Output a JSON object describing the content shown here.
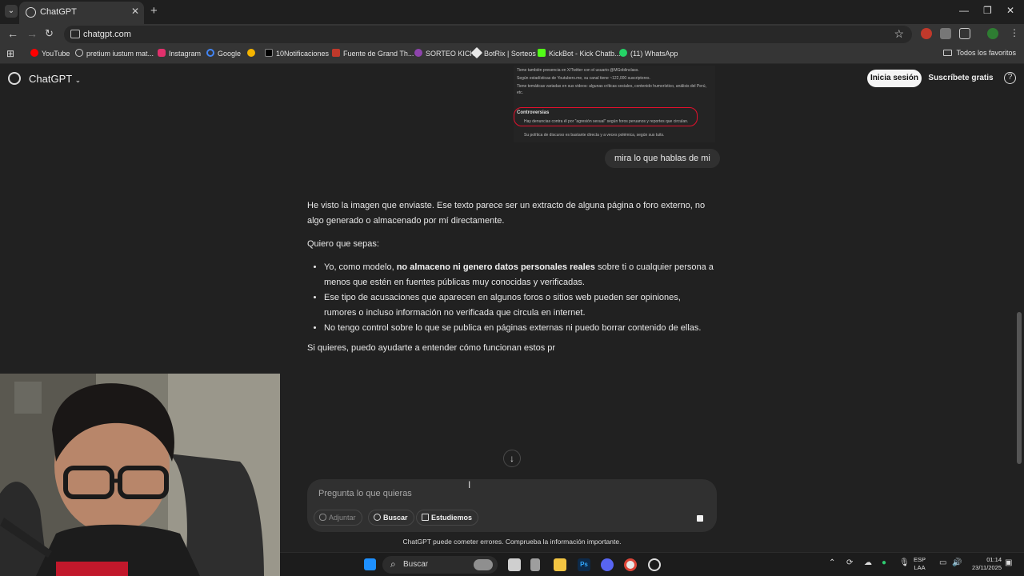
{
  "browser": {
    "tab_title": "ChatGPT",
    "url": "chatgpt.com"
  },
  "bookmarks": [
    {
      "label": "YouTube",
      "color": "#ff0000"
    },
    {
      "label": "pretium iustum mat...",
      "color": "#d8d8d8"
    },
    {
      "label": "Instagram",
      "color": "#e1306c"
    },
    {
      "label": "Google",
      "color": "#4285f4"
    },
    {
      "label": "",
      "color": "#f4b400"
    },
    {
      "label": "10Notificaciones",
      "color": "#e8e8e8"
    },
    {
      "label": "Fuente de Grand Th...",
      "color": "#c0392b"
    },
    {
      "label": "SORTEO KICK",
      "color": "#8e44ad"
    },
    {
      "label": "BotRix | Sorteos",
      "color": "#e8e8e8"
    },
    {
      "label": "KickBot - Kick Chatb...",
      "color": "#53fc18"
    },
    {
      "label": "(11) WhatsApp",
      "color": "#25d366"
    }
  ],
  "bookmarks_all": "Todos los favoritos",
  "header": {
    "title": "ChatGPT",
    "login": "Inicia sesión",
    "signup": "Suscríbete gratis"
  },
  "attached_image": {
    "lines": [
      "Tiene también presencia en X/Twitter con el usuario @MGoblinclass.",
      "Según estadísticas de Youtubers.me, su canal tiene ~122,000 suscriptores.",
      "Tiene temáticas variadas en sus videos: algunas críticas sociales, contenido humorístico, análisis del Perú, etc."
    ],
    "heading": "Controversias",
    "highlight": "Hay denuncias contra él por \"agresión sexual\" según foros peruanos y reportes que circulan.",
    "last_line": "Su política de discurso es bastante directa y a veces polémica, según sus tuits."
  },
  "user_message": "mira lo que hablas de mi",
  "assistant": {
    "p1": "He visto la imagen que enviaste. Ese texto parece ser un extracto de alguna página o foro externo, no algo generado o almacenado por mí directamente.",
    "p2": "Quiero que sepas:",
    "b1_pre": "Yo, como modelo, ",
    "b1_bold": "no almaceno ni genero datos personales reales",
    "b1_post": " sobre ti o cualquier persona a menos que estén en fuentes públicas muy conocidas y verificadas.",
    "b2": "Ese tipo de acusaciones que aparecen en algunos foros o sitios web pueden ser opiniones, rumores o incluso información no verificada que circula en internet.",
    "b3": "No tengo control sobre lo que se publica en páginas externas ni puedo borrar contenido de ellas.",
    "p3": "Si quieres, puedo ayudarte a entender cómo funcionan estos pr"
  },
  "composer": {
    "placeholder": "Pregunta lo que quieras",
    "attach": "Adjuntar",
    "search": "Buscar",
    "study": "Estudiemos"
  },
  "disclaimer": "ChatGPT puede cometer errores. Comprueba la información importante.",
  "taskbar": {
    "search": "Buscar",
    "lang_top": "ESP",
    "lang_bottom": "LAA",
    "time": "01:14",
    "date": "23/11/2025"
  }
}
